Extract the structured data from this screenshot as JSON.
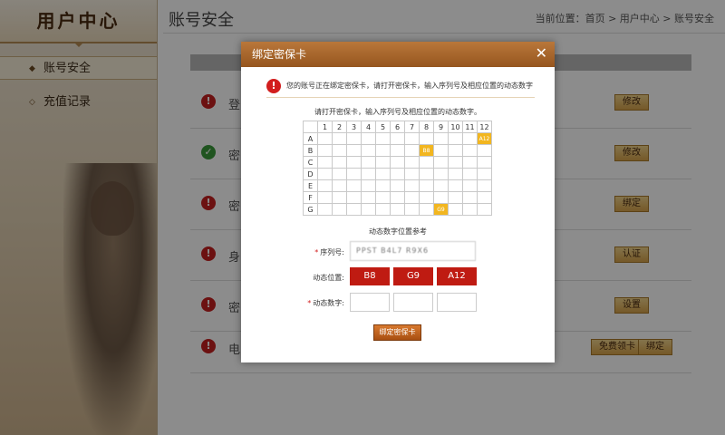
{
  "sidebar": {
    "title": "用户中心",
    "items": [
      {
        "label": "账号安全",
        "bullet": "◆",
        "active": true
      },
      {
        "label": "充值记录",
        "bullet": "◇",
        "active": false
      }
    ]
  },
  "main": {
    "title": "账号安全",
    "breadcrumb": "当前位置：首页 > 用户中心 > 账号安全",
    "rows": [
      {
        "status": "error",
        "label": "登",
        "buttons": [
          "修改"
        ]
      },
      {
        "status": "ok",
        "label": "密",
        "buttons": [
          "修改"
        ]
      },
      {
        "status": "error",
        "label": "密",
        "buttons": [
          "绑定"
        ]
      },
      {
        "status": "error",
        "label": "身",
        "buttons": [
          "认证"
        ]
      },
      {
        "status": "error",
        "label": "密",
        "buttons": [
          "设置"
        ]
      },
      {
        "status": "error",
        "label": "电",
        "buttons": [
          "免费领卡",
          "绑定"
        ]
      }
    ]
  },
  "modal": {
    "title": "绑定密保卡",
    "close_glyph": "✕",
    "notice_icon_glyph": "!",
    "notice": "您的账号正在绑定密保卡，请打开密保卡，输入序列号及相应位置的动态数字",
    "instruction": "请打开密保卡，输入序列号及相应位置的动态数字。",
    "grid": {
      "columns": [
        "1",
        "2",
        "3",
        "4",
        "5",
        "6",
        "7",
        "8",
        "9",
        "10",
        "11",
        "12"
      ],
      "rows": [
        "A",
        "B",
        "C",
        "D",
        "E",
        "F",
        "G"
      ],
      "highlights": [
        {
          "row": "A",
          "col": "12",
          "text": "A12"
        },
        {
          "row": "B",
          "col": "8",
          "text": "B8"
        },
        {
          "row": "G",
          "col": "9",
          "text": "G9"
        }
      ]
    },
    "caption": "动态数字位置参考",
    "serial_label": "序列号:",
    "serial_value": "PPST B4L7 R9X6",
    "position_label": "动态位置:",
    "positions": [
      "B8",
      "G9",
      "A12"
    ],
    "digits_label": "动态数字:",
    "digits": [
      "",
      "",
      ""
    ],
    "required_mark": "*",
    "submit_label": "绑定密保卡"
  },
  "colors": {
    "modal_header": "#a8652b",
    "position_box": "#bf1b12",
    "highlight_cell": "#f2b620",
    "error_icon": "#c52020",
    "ok_icon": "#3a9a3a"
  }
}
